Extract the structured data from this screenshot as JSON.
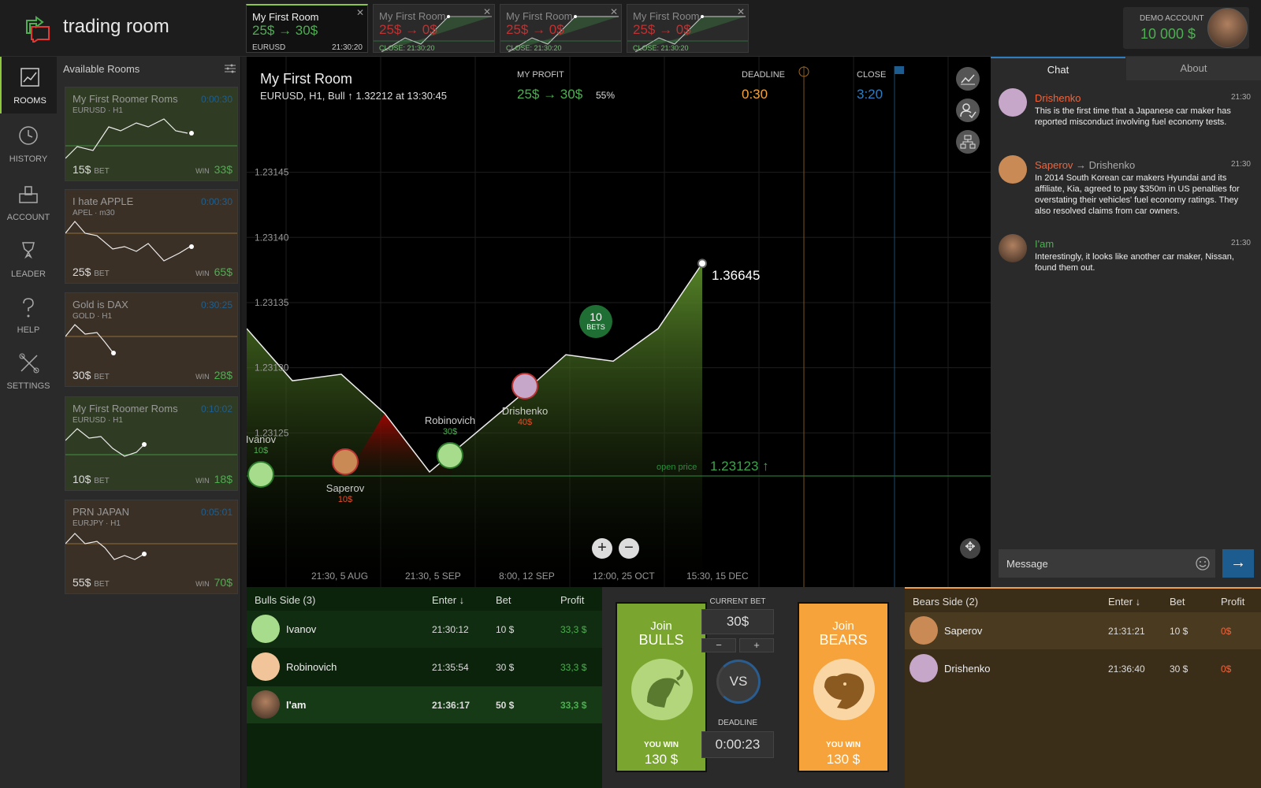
{
  "app": {
    "title": "trading room"
  },
  "tabs": [
    {
      "name": "My First Room",
      "profit": "25$ → 30$",
      "symbol": "EURUSD",
      "time": "21:30:20"
    },
    {
      "name": "My First Room",
      "profit": "25$ → 0$",
      "close": "CLOSE: 21:30:20"
    },
    {
      "name": "My First Room",
      "profit": "25$ → 0$",
      "close": "CLOSE: 21:30:20"
    },
    {
      "name": "My First Room",
      "profit": "25$ → 0$",
      "close": "CLOSE: 21:30:20"
    }
  ],
  "account": {
    "label": "DEMO ACCOUNT",
    "value": "10 000 $"
  },
  "nav": [
    {
      "label": "ROOMS",
      "icon": "rooms-icon"
    },
    {
      "label": "HISTORY",
      "icon": "clock-icon"
    },
    {
      "label": "ACCOUNT",
      "icon": "account-icon"
    },
    {
      "label": "LEADER",
      "icon": "trophy-icon"
    },
    {
      "label": "HELP",
      "icon": "help-icon"
    },
    {
      "label": "SETTINGS",
      "icon": "tools-icon"
    }
  ],
  "rooms": {
    "title": "Available Rooms",
    "bet_label": "BET",
    "win_label": "WIN",
    "items": [
      {
        "name": "My First Roomer Roms",
        "symbol": "EURUSD · H1",
        "time": "0:00:30",
        "bet": "15$",
        "win": "33$"
      },
      {
        "name": "I hate APPLE",
        "symbol": "APEL · m30",
        "time": "0:00:30",
        "bet": "25$",
        "win": "65$"
      },
      {
        "name": "Gold is DAX",
        "symbol": "GOLD · H1",
        "time": "0:30:25",
        "bet": "30$",
        "win": "28$"
      },
      {
        "name": "My First Roomer Roms",
        "symbol": "EURUSD · H1",
        "time": "0:10:02",
        "bet": "10$",
        "win": "18$"
      },
      {
        "name": "PRN JAPAN",
        "symbol": "EURJPY · H1",
        "time": "0:05:01",
        "bet": "55$",
        "win": "70$"
      }
    ]
  },
  "chart": {
    "title": "My First Room",
    "subtitle": "EURUSD, H1, Bull ↑ 1.32212 at 13:30:45",
    "profit_label": "MY PROFIT",
    "profit_value": "25$ → 30$",
    "profit_pct": "55%",
    "deadline_label": "DEADLINE",
    "deadline_value": "0:30",
    "close_label": "CLOSE",
    "close_value": "3:20",
    "last_value": "1.36645",
    "open_price_label": "open price",
    "open_price_value": "1.23123 ↑",
    "bets_count": "10",
    "bets_label": "BETS",
    "zoom_in": "+",
    "zoom_out": "−"
  },
  "chart_data": {
    "type": "area",
    "y_ticks": [
      "1.23145",
      "1.23140",
      "1.23135",
      "1.23130",
      "1.23125"
    ],
    "x_ticks": [
      "21:30, 5 AUG",
      "21:30, 5 SEP",
      "8:00, 12 SEP",
      "12:00, 25 OCT",
      "15:30, 15 DEC"
    ],
    "ylim": [
      1.2312,
      1.23148
    ],
    "open_price": 1.23123,
    "series": [
      {
        "values": [
          1.23133,
          1.23129,
          1.231295,
          1.231265,
          1.23122,
          1.23128,
          1.23131,
          1.231305,
          1.23133,
          1.23138,
          1.23137
        ]
      }
    ],
    "markers": [
      {
        "name": "Ivanov",
        "bet": "10$",
        "side": "bull"
      },
      {
        "name": "Saperov",
        "bet": "10$",
        "side": "bear"
      },
      {
        "name": "Robinovich",
        "bet": "30$",
        "side": "bull"
      },
      {
        "name": "Drishenko",
        "bet": "40$",
        "side": "bear"
      }
    ]
  },
  "chat": {
    "tab_chat": "Chat",
    "tab_about": "About",
    "messages": [
      {
        "from": "Drishenko",
        "to": "",
        "time": "21:30",
        "text": "This is the first time that a Japanese car maker has reported misconduct involving fuel economy tests."
      },
      {
        "from": "Saperov",
        "to": "→ Drishenko",
        "time": "21:30",
        "text": "In 2014 South Korean car makers Hyundai and its affiliate, Kia, agreed to pay $350m in US penalties for overstating their vehicles' fuel economy ratings. They also resolved claims from car owners."
      },
      {
        "from": "I'am",
        "to": "",
        "time": "21:30",
        "text": "Interestingly, it looks like another car maker, Nissan, found them out."
      }
    ],
    "input_value": "Message",
    "send": "→"
  },
  "bulls": {
    "header": {
      "side": "Bulls Side (3)",
      "enter": "Enter ↓",
      "bet": "Bet",
      "profit": "Profit"
    },
    "rows": [
      {
        "name": "Ivanov",
        "enter": "21:30:12",
        "bet": "10 $",
        "profit": "33,3 $"
      },
      {
        "name": "Robinovich",
        "enter": "21:35:54",
        "bet": "30 $",
        "profit": "33,3 $"
      },
      {
        "name": "I'am",
        "enter": "21:36:17",
        "bet": "50 $",
        "profit": "33,3 $"
      }
    ]
  },
  "bears": {
    "header": {
      "side": "Bears Side (2)",
      "enter": "Enter ↓",
      "bet": "Bet",
      "profit": "Profit"
    },
    "rows": [
      {
        "name": "Saperov",
        "enter": "21:31:21",
        "bet": "10 $",
        "profit": "0$"
      },
      {
        "name": "Drishenko",
        "enter": "21:36:40",
        "bet": "30 $",
        "profit": "0$"
      }
    ]
  },
  "join": {
    "bulls_join": "Join",
    "bulls_label": "BULLS",
    "bulls_win_label": "YOU WIN",
    "bulls_win": "130 $",
    "bears_join": "Join",
    "bears_label": "BEARS",
    "bears_win_label": "YOU WIN",
    "bears_win": "130 $",
    "current_bet_label": "CURRENT BET",
    "current_bet": "30$",
    "minus": "−",
    "plus": "+",
    "vs": "VS",
    "deadline_label": "DEADLINE",
    "deadline": "0:00:23",
    "colors": {
      "bulls": "#7aa630",
      "bears": "#f5a33a"
    }
  }
}
